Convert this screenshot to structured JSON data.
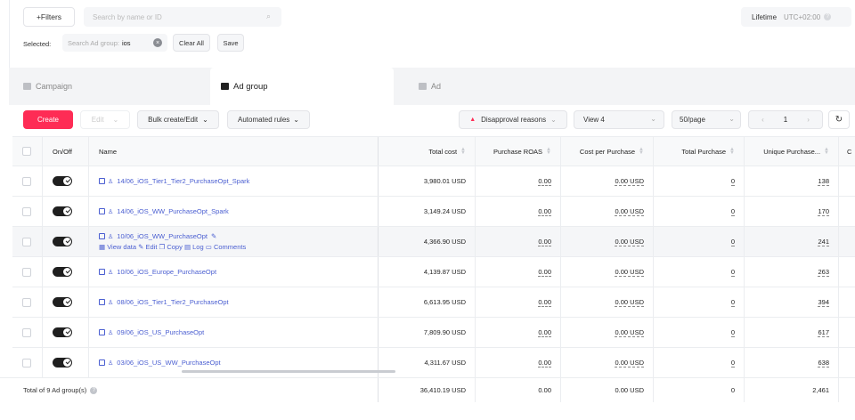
{
  "filters": {
    "filters_button": "+Filters",
    "search_placeholder": "Search by name or ID",
    "lifetime": "Lifetime",
    "timezone": "UTC+02:00",
    "selected_label": "Selected:",
    "chip_key": "Search Ad group:",
    "chip_value": "ios",
    "clear_all": "Clear All",
    "save": "Save"
  },
  "tabs": [
    {
      "label": "Campaign"
    },
    {
      "label": "Ad group"
    },
    {
      "label": "Ad"
    }
  ],
  "toolbar": {
    "create": "Create",
    "edit": "Edit",
    "bulk": "Bulk create/Edit",
    "automated": "Automated rules",
    "disapproval": "Disapproval reasons",
    "view": "View 4",
    "per_page": "50/page",
    "page": "1"
  },
  "columns": {
    "onoff": "On/Off",
    "name": "Name",
    "total_cost": "Total cost",
    "roas": "Purchase ROAS",
    "cpp": "Cost per Purchase",
    "total_purchase": "Total Purchase",
    "unique_purchase": "Unique Purchase...",
    "cut": "C"
  },
  "rows": [
    {
      "name": "14/06_iOS_Tier1_Tier2_PurchaseOpt_Spark",
      "cost": "3,980.01 USD",
      "roas": "0.00",
      "cpp": "0.00 USD",
      "tp": "0",
      "up": "138"
    },
    {
      "name": "14/06_iOS_WW_PurchaseOpt_Spark",
      "cost": "3,149.24 USD",
      "roas": "0.00",
      "cpp": "0.00 USD",
      "tp": "0",
      "up": "170"
    },
    {
      "name": "10/06_iOS_WW_PurchaseOpt",
      "cost": "4,366.90 USD",
      "roas": "0.00",
      "cpp": "0.00 USD",
      "tp": "0",
      "up": "241"
    },
    {
      "name": "10/06_iOS_Europe_PurchaseOpt",
      "cost": "4,139.87 USD",
      "roas": "0.00",
      "cpp": "0.00 USD",
      "tp": "0",
      "up": "263"
    },
    {
      "name": "08/06_iOS_Tier1_Tier2_PurchaseOpt",
      "cost": "6,613.95 USD",
      "roas": "0.00",
      "cpp": "0.00 USD",
      "tp": "0",
      "up": "394"
    },
    {
      "name": "09/06_iOS_US_PurchaseOpt",
      "cost": "7,809.90 USD",
      "roas": "0.00",
      "cpp": "0.00 USD",
      "tp": "0",
      "up": "617"
    },
    {
      "name": "03/06_iOS_US_WW_PurchaseOpt",
      "cost": "4,311.67 USD",
      "roas": "0.00",
      "cpp": "0.00 USD",
      "tp": "0",
      "up": "638"
    }
  ],
  "row_actions": {
    "view_data": "View data",
    "edit": "Edit",
    "copy": "Copy",
    "log": "Log",
    "comments": "Comments"
  },
  "footer": {
    "label": "Total of 9 Ad group(s)",
    "cost": "36,410.19 USD",
    "roas": "0.00",
    "cpp": "0.00 USD",
    "tp": "0",
    "up": "2,461"
  },
  "colors": {
    "accent": "#fe2c55",
    "link": "#4a5ed1"
  }
}
